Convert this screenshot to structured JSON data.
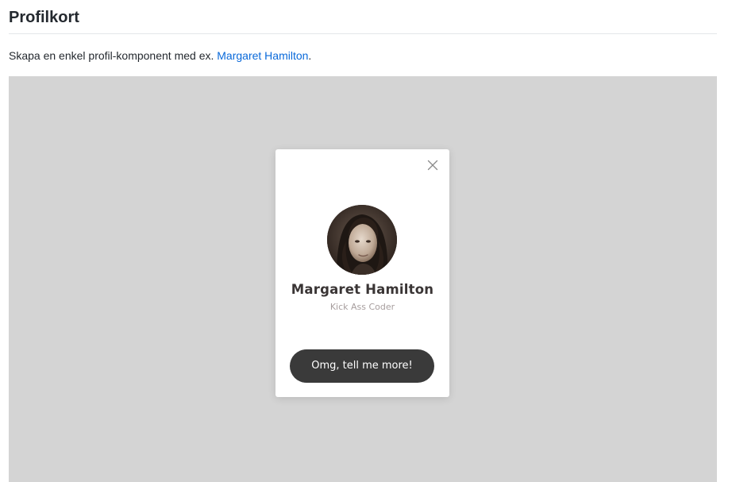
{
  "heading": "Profilkort",
  "intro": {
    "text_before": "Skapa en enkel profil-komponent med ex. ",
    "link_label": "Margaret Hamilton",
    "text_after": "."
  },
  "card": {
    "close_icon": "close-icon",
    "avatar_icon": "portrait-photo",
    "name": "Margaret Hamilton",
    "role": "Kick Ass Coder",
    "button_label": "Omg, tell me more!"
  },
  "colors": {
    "stage_background": "#d4d4d4",
    "card_background": "#ffffff",
    "button_background": "#3a3a3a",
    "link": "#0969da",
    "name_text": "#3a3535",
    "role_text": "#a79e9e"
  }
}
